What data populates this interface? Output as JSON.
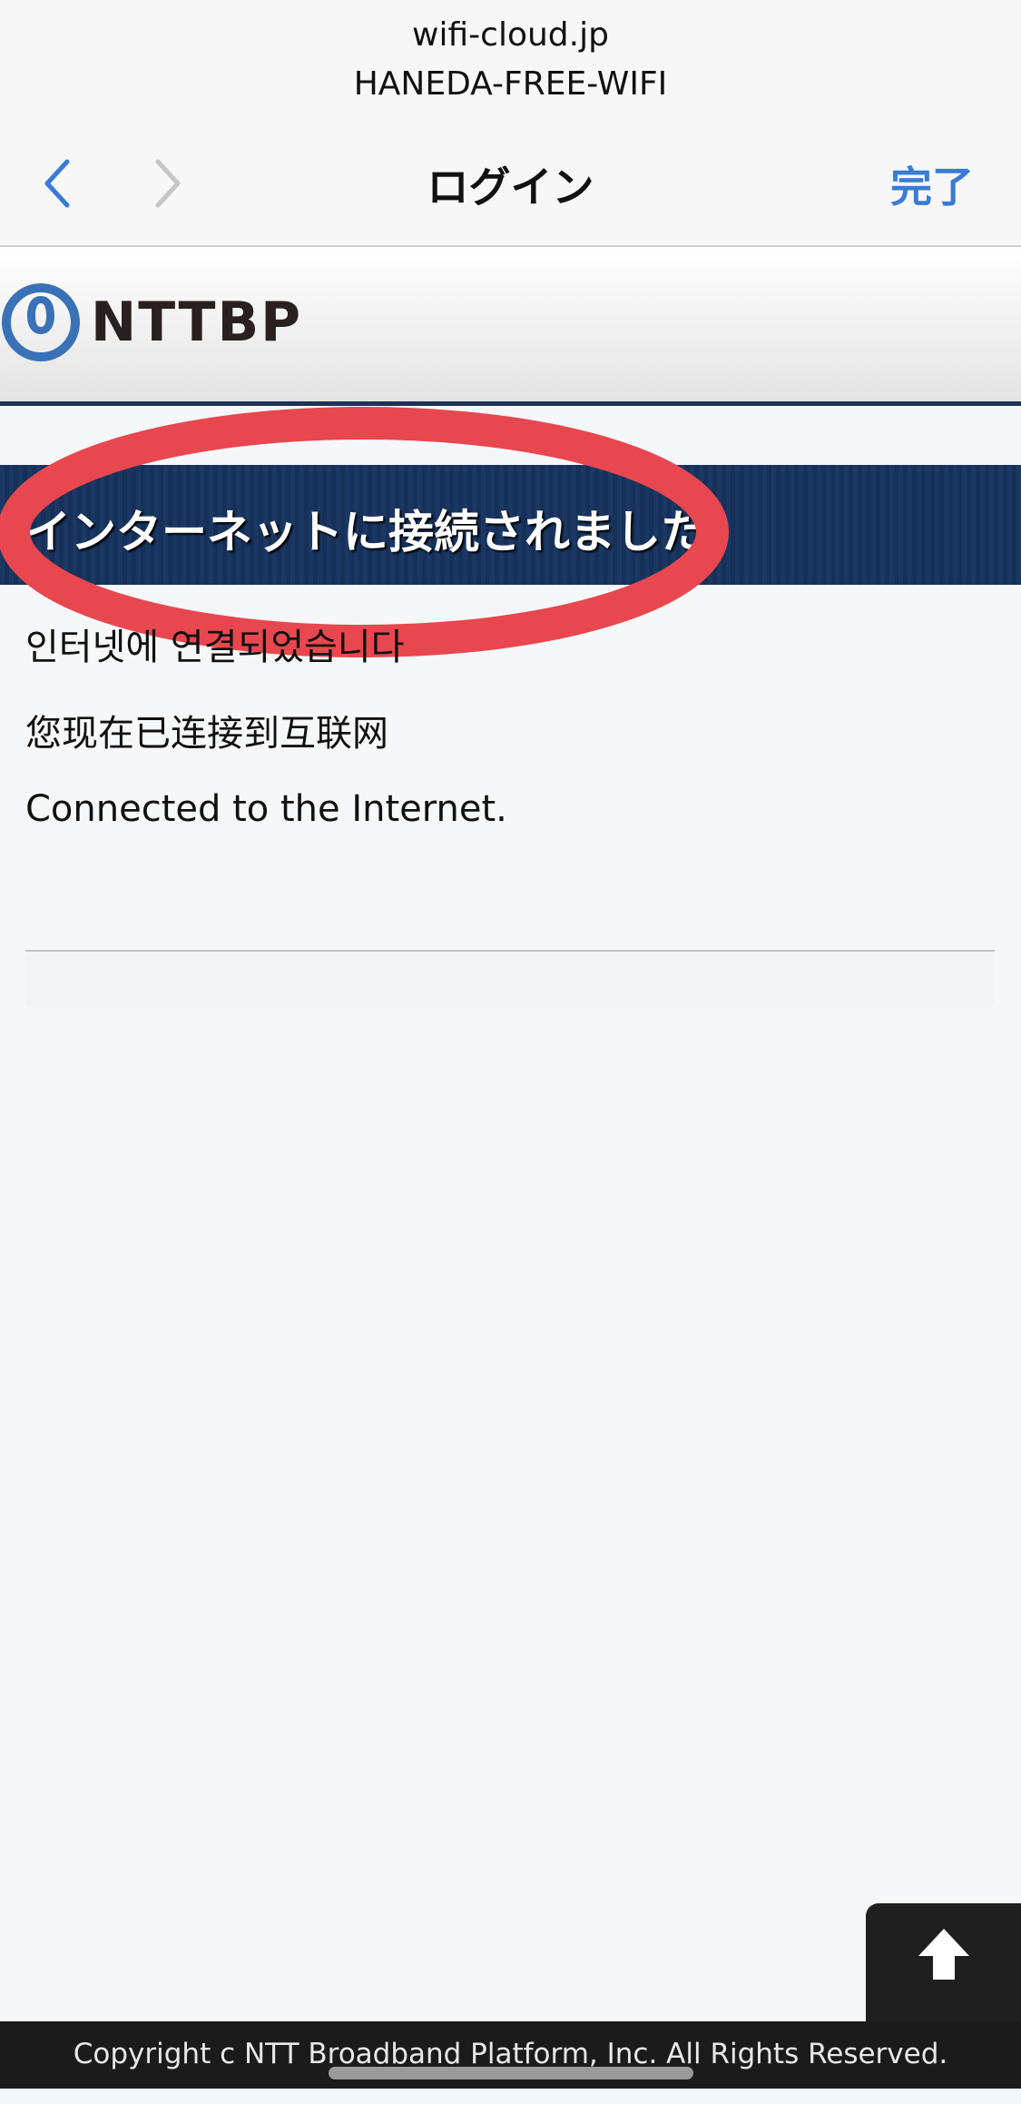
{
  "topbar": {
    "domain": "wifi-cloud.jp",
    "ssid": "HANEDA-FREE-WIFI",
    "title": "ログイン",
    "done_label": "完了",
    "accent_color": "#3a7bd5"
  },
  "brand": {
    "name": "NTTBP",
    "logo_color": "#3a72b8",
    "header_rule_color": "#1d3358"
  },
  "banner": {
    "text": "インターネットに接続されました。",
    "background_color": "#1b3865"
  },
  "highlight": {
    "color": "#e8474f"
  },
  "messages": {
    "korean": "인터넷에 연결되었습니다",
    "chinese": "您现在已连接到互联网",
    "english": "Connected to the Internet."
  },
  "icons": {
    "back": "chevron-left-icon",
    "forward": "chevron-right-icon",
    "scroll_top": "arrow-up-icon"
  },
  "footer": {
    "copyright": "Copyright c NTT Broadband Platform, Inc. All Rights Reserved."
  }
}
